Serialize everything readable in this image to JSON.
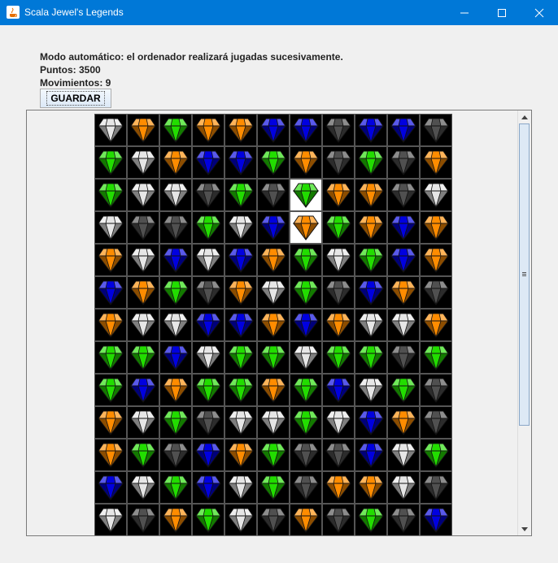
{
  "window": {
    "title": "Scala Jewel's Legends"
  },
  "status": {
    "mode": "Modo automático: el ordenador realizará jugadas sucesivamente.",
    "points": "Puntos: 3500",
    "moves": "Movimientos: 9"
  },
  "toolbar": {
    "save_label": "GUARDAR"
  },
  "colors": {
    "orange": "#ff8c00",
    "green": "#22dd00",
    "white": "#e6e6e6",
    "blue": "#0000e0",
    "gray": "#505050",
    "accent": "#0078d7"
  },
  "board": {
    "rows": [
      "WOGOOBBKBBK",
      "GWOBBGOKGKO",
      "GWWKGKgOOKW",
      "WKKGWBoGOBO",
      "OWBWBOGWGBO",
      "BOGKOWGKBOK",
      "OWWBBOBOWWO",
      "GGBWGGWGGKG",
      "GBOGGOGBWGK",
      "OWGKWWGWBOK",
      "OGKBOGKKBWG",
      "BWGBWGKOOWK",
      "WKOGWKOKGKB"
    ],
    "selected": [
      [
        2,
        6
      ],
      [
        3,
        6
      ]
    ]
  }
}
